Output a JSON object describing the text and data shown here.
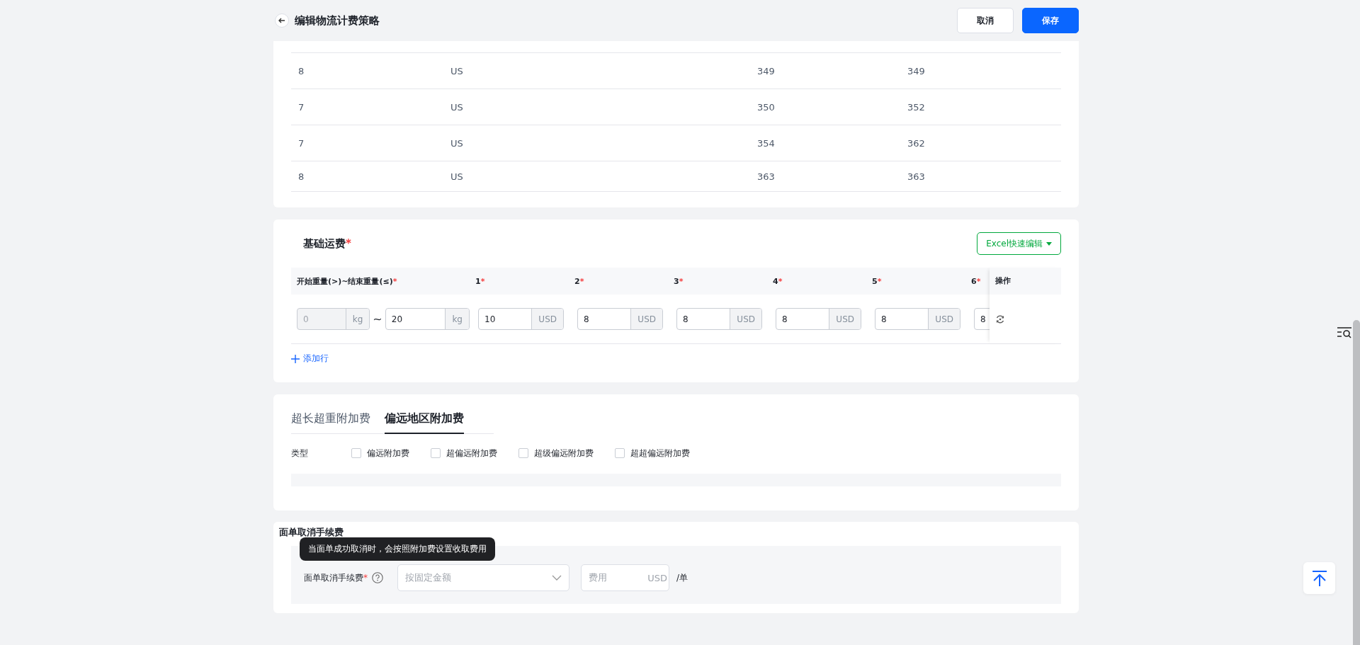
{
  "header": {
    "title": "编辑物流计费策略",
    "buttons": [
      {
        "label": "取消",
        "kind": "default"
      },
      {
        "label": "保存",
        "kind": "primary"
      }
    ]
  },
  "zone_table": {
    "rows": [
      [
        "8",
        "US",
        "349",
        "349"
      ],
      [
        "7",
        "US",
        "350",
        "352"
      ],
      [
        "7",
        "US",
        "354",
        "362"
      ],
      [
        "8",
        "US",
        "363",
        "363"
      ]
    ]
  },
  "base_freight": {
    "title": "基础运费",
    "required_mark": "*",
    "excel_button": "Excel快速编辑",
    "columns": [
      {
        "label": "开始重量(>)~结束重量(≤)",
        "required_mark": "*"
      },
      {
        "label": "1",
        "required_mark": "*"
      },
      {
        "label": "2",
        "required_mark": "*"
      },
      {
        "label": "3",
        "required_mark": "*"
      },
      {
        "label": "4",
        "required_mark": "*"
      },
      {
        "label": "5",
        "required_mark": "*"
      },
      {
        "label": "6",
        "required_mark": "*"
      }
    ],
    "action_column": "操作",
    "rows": [
      {
        "start": {
          "value": "0",
          "unit": "kg",
          "disabled": true
        },
        "separator": "~",
        "end": {
          "value": "20",
          "unit": "kg",
          "disabled": false
        },
        "prices": [
          {
            "value": "10",
            "unit": "USD"
          },
          {
            "value": "8",
            "unit": "USD"
          },
          {
            "value": "8",
            "unit": "USD"
          },
          {
            "value": "8",
            "unit": "USD"
          },
          {
            "value": "8",
            "unit": "USD"
          },
          {
            "value": "8"
          }
        ]
      }
    ],
    "add_row": "添加行"
  },
  "surcharge": {
    "tabs": [
      {
        "label": "超长超重附加费",
        "selected": false
      },
      {
        "label": "偏远地区附加费",
        "selected": true
      }
    ],
    "type_label": "类型",
    "options": [
      {
        "label": "偏远附加费",
        "checked": false
      },
      {
        "label": "超偏远附加费",
        "checked": false
      },
      {
        "label": "超级偏远附加费",
        "checked": false
      },
      {
        "label": "超超偏远附加费",
        "checked": false
      }
    ]
  },
  "cancel_fee": {
    "title": "面单取消手续费",
    "tooltip": "当面单成功取消时，会按照附加费设置收取费用",
    "label": "面单取消手续费",
    "required_mark": "*",
    "select": {
      "placeholder": "按固定金额"
    },
    "fee": {
      "placeholder": "费用",
      "unit": "USD"
    },
    "suffix": "/单"
  }
}
